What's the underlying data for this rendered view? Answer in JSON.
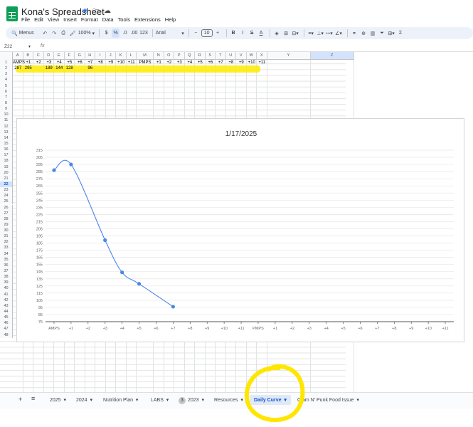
{
  "app": {
    "title": "Kona's Spreadsheet",
    "menu": [
      "File",
      "Edit",
      "View",
      "Insert",
      "Format",
      "Data",
      "Tools",
      "Extensions",
      "Help"
    ]
  },
  "toolbar": {
    "menus_label": "Menus",
    "zoom": "100%",
    "currency": "$",
    "percent": "%",
    "decimal_less": ".0",
    "decimal_more": ".00",
    "number_format": "123",
    "font": "Arial",
    "font_size": "10"
  },
  "formula_bar": {
    "name_box": "Z22",
    "fx": "fx"
  },
  "sheet": {
    "columns": [
      "A",
      "B",
      "C",
      "D",
      "E",
      "F",
      "G",
      "H",
      "I",
      "J",
      "K",
      "L",
      "M",
      "N",
      "O",
      "P",
      "Q",
      "R",
      "S",
      "T",
      "U",
      "V",
      "W",
      "X",
      "Y",
      "Z"
    ],
    "rows": [
      "1",
      "2",
      "3",
      "4",
      "5",
      "6",
      "7",
      "8",
      "9",
      "10",
      "11",
      "12",
      "13",
      "14",
      "15",
      "16",
      "17",
      "18",
      "19",
      "20",
      "21",
      "22",
      "23",
      "24",
      "25",
      "26",
      "27",
      "28",
      "29",
      "30",
      "31",
      "32",
      "33",
      "34",
      "35",
      "36",
      "37",
      "38",
      "39",
      "40",
      "41",
      "42",
      "43",
      "44",
      "45",
      "46",
      "47",
      "48"
    ],
    "row1": [
      "AMPS",
      "+1",
      "+2",
      "+3",
      "+4",
      "+5",
      "+6",
      "+7",
      "+8",
      "+9",
      "+10",
      "+11",
      "PMPS",
      "+1",
      "+2",
      "+3",
      "+4",
      "+5",
      "+6",
      "+7",
      "+8",
      "+9",
      "+10",
      "+11"
    ],
    "row2": [
      "287",
      "295",
      "",
      "189",
      "144",
      "128",
      "",
      "96"
    ],
    "selected_cell": "Z22"
  },
  "chart_data": {
    "type": "line",
    "title": "1/17/2025",
    "categories": [
      "AMPS",
      "+1",
      "+2",
      "+3",
      "+4",
      "+5",
      "+6",
      "+7",
      "+8",
      "+9",
      "+10",
      "+11",
      "PMPS",
      "+1",
      "+2",
      "+3",
      "+4",
      "+5",
      "+6",
      "+7",
      "+8",
      "+9",
      "+10",
      "+11"
    ],
    "series": [
      {
        "values": [
          287,
          295,
          null,
          189,
          144,
          128,
          null,
          96,
          null,
          null,
          null,
          null,
          null,
          null,
          null,
          null,
          null,
          null,
          null,
          null,
          null,
          null,
          null,
          null
        ],
        "color": "#4a86e8"
      }
    ],
    "yticks": [
      75,
      85,
      95,
      105,
      115,
      125,
      135,
      145,
      155,
      165,
      175,
      185,
      195,
      205,
      215,
      225,
      235,
      245,
      255,
      265,
      275,
      285,
      295,
      305,
      315
    ],
    "ylim": [
      75,
      315
    ],
    "grid": true,
    "legend": "none"
  },
  "tabs": [
    {
      "label": "2025"
    },
    {
      "label": "2024"
    },
    {
      "label": "Nutrition Plan"
    },
    {
      "label": "LABS"
    },
    {
      "label": "2023",
      "badge": "3"
    },
    {
      "label": "Resources"
    },
    {
      "label": "Daily Curve",
      "active": true
    },
    {
      "label": "Glam N' Punk Food Issue"
    }
  ],
  "colors": {
    "accent": "#0b57d0",
    "highlight": "#ffeb00",
    "series": "#4a86e8",
    "sheets_green": "#0f9d58"
  }
}
